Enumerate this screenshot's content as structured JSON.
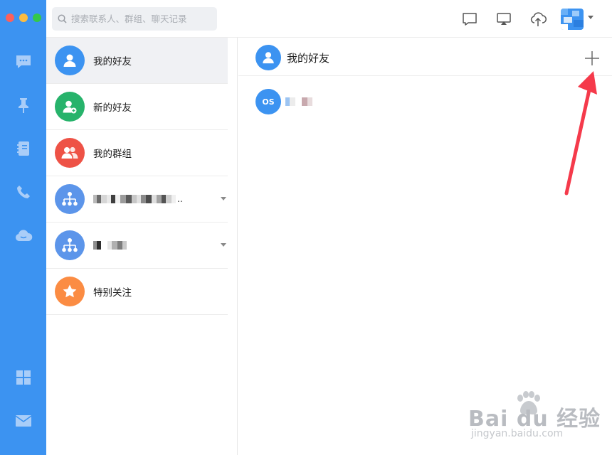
{
  "window": {
    "controls": [
      "close",
      "minimize",
      "maximize"
    ],
    "control_colors": [
      "#fc605b",
      "#fdbc40",
      "#34c84a"
    ]
  },
  "search": {
    "placeholder": "搜索联系人、群组、聊天记录",
    "value": ""
  },
  "rail": {
    "items": [
      {
        "icon": "chat-bubble-icon",
        "name": "消息"
      },
      {
        "icon": "pin-icon",
        "name": "置顶"
      },
      {
        "icon": "contacts-book-icon",
        "name": "通讯录"
      },
      {
        "icon": "phone-icon",
        "name": "电话"
      },
      {
        "icon": "cloud-icon",
        "name": "云"
      },
      {
        "icon": "apps-grid-icon",
        "name": "应用"
      },
      {
        "icon": "mail-icon",
        "name": "邮件"
      }
    ]
  },
  "topbar": {
    "icons": [
      "message-icon",
      "screen-share-icon",
      "cloud-upload-icon"
    ]
  },
  "contacts": {
    "items": [
      {
        "label": "我的好友",
        "icon": "user-icon",
        "color": "#3c93f1",
        "active": true
      },
      {
        "label": "新的好友",
        "icon": "add-user-icon",
        "color": "#27b36b",
        "active": false
      },
      {
        "label": "我的群组",
        "icon": "group-icon",
        "color": "#ee5246",
        "active": false
      },
      {
        "label": "",
        "icon": "org-chart-icon",
        "color": "#5c95ea",
        "active": false,
        "redacted": true,
        "suffix": "..",
        "expandable": true
      },
      {
        "label": "",
        "icon": "org-chart-icon",
        "color": "#5c95ea",
        "active": false,
        "redacted": true,
        "expandable": true
      },
      {
        "label": "特别关注",
        "icon": "star-icon",
        "color": "#fb8c43",
        "active": false
      }
    ]
  },
  "detail": {
    "title": "我的好友",
    "friend": {
      "initials": "OS",
      "name_redacted": true
    }
  },
  "watermark": {
    "logo": "Bai du 经验",
    "url": "jingyan.baidu.com"
  },
  "colors": {
    "brand": "#3c93f1",
    "annotation_arrow": "#f53a4b"
  }
}
